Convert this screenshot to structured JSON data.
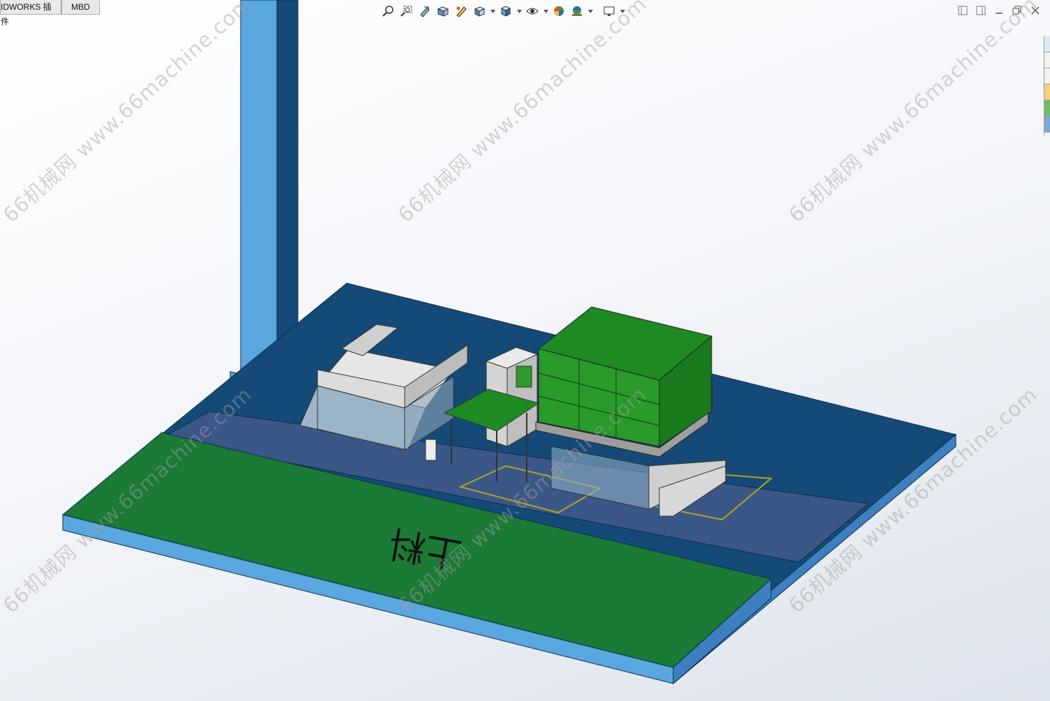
{
  "app": {
    "tabs": [
      {
        "label": "IDWORKS 插件"
      },
      {
        "label": "MBD"
      }
    ]
  },
  "toolbar": {
    "icons": [
      "zoom-to-fit-icon",
      "zoom-to-area-icon",
      "previous-view-icon",
      "section-view-icon",
      "dynamic-annotation-icon",
      "view-orientation-icon",
      "display-style-icon",
      "hide-show-items-icon",
      "edit-appearance-icon",
      "apply-scene-icon",
      "view-settings-icon"
    ]
  },
  "window_controls": [
    "tile-left-icon",
    "tile-right-icon",
    "restore-icon",
    "close-icon"
  ],
  "scene": {
    "floor_text": "上料",
    "colors": {
      "column": "#5aa6df",
      "column_dark": "#154a78",
      "base_blue": "#154a78",
      "base_edge": "#5aa6df",
      "walkway": "#3a5787",
      "green_zone": "#1a7a36",
      "cart_green": "#1e8a22",
      "gray_machine": "#dcdcdc",
      "yellow_line": "#b6a11c"
    }
  },
  "watermark": {
    "text": "66机械网 www.66machine.com"
  }
}
